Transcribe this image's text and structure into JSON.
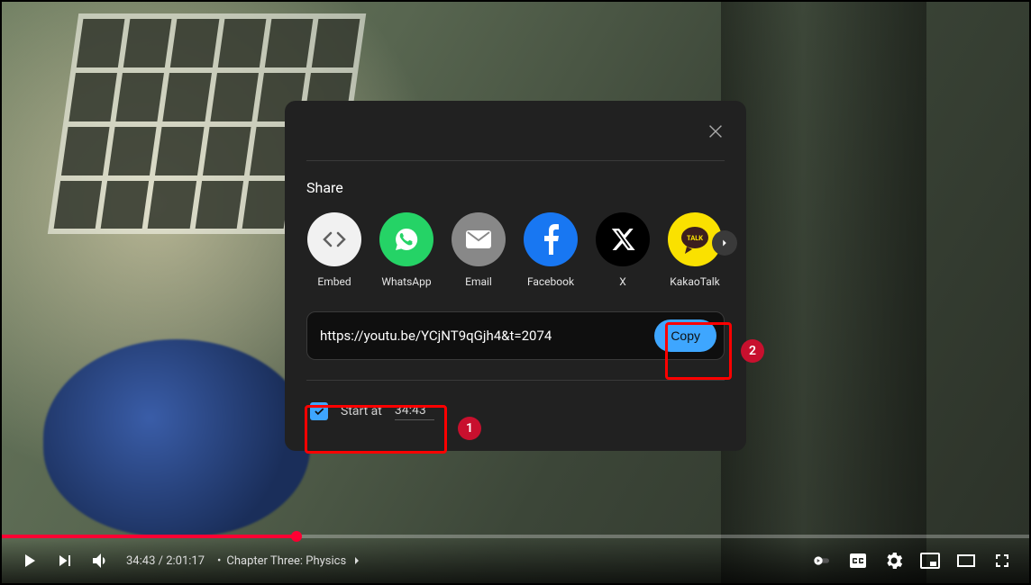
{
  "player": {
    "current_time": "34:43",
    "duration": "2:01:17",
    "separator": " / ",
    "bullet": "•",
    "chapter_label": "Chapter Three: Physics",
    "progress_fraction": 0.2865
  },
  "dialog": {
    "title": "Share",
    "share_targets": [
      {
        "id": "embed",
        "label": "Embed",
        "bg": "#f1f1f1",
        "glyph": "< >",
        "glyph_color": "#606060"
      },
      {
        "id": "whatsapp",
        "label": "WhatsApp",
        "bg": "#25d366",
        "glyph": "wa",
        "glyph_color": "#ffffff"
      },
      {
        "id": "email",
        "label": "Email",
        "bg": "#888888",
        "glyph": "mail",
        "glyph_color": "#ffffff"
      },
      {
        "id": "facebook",
        "label": "Facebook",
        "bg": "#1877f2",
        "glyph": "f",
        "glyph_color": "#ffffff"
      },
      {
        "id": "x",
        "label": "X",
        "bg": "#000000",
        "glyph": "x",
        "glyph_color": "#ffffff"
      },
      {
        "id": "kakaotalk",
        "label": "KakaoTalk",
        "bg": "#fae100",
        "glyph": "TALK",
        "glyph_color": "#3c1e1e"
      }
    ],
    "url": "https://youtu.be/YCjNT9qGjh4&t=2074",
    "copy_label": "Copy",
    "start_at": {
      "checked": true,
      "label": "Start at",
      "time": "34:43"
    }
  },
  "annotations": {
    "one": "1",
    "two": "2"
  }
}
